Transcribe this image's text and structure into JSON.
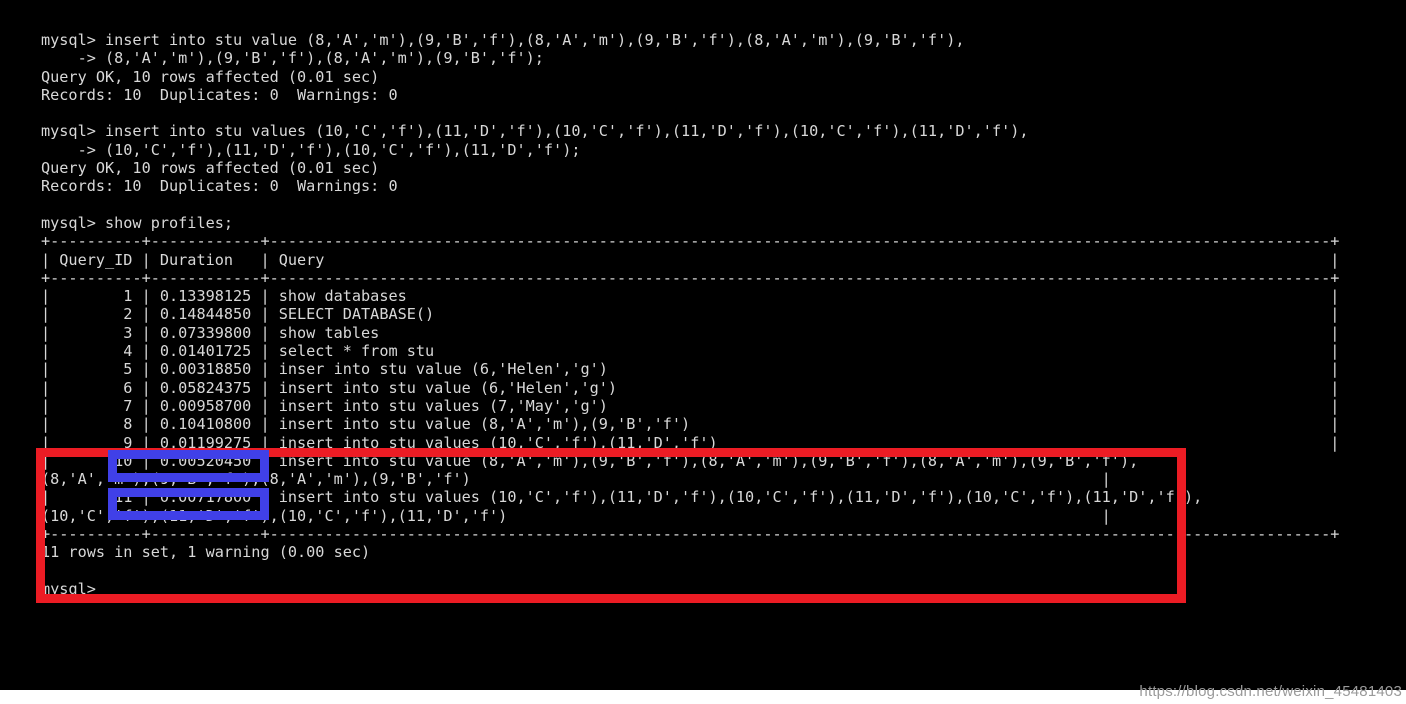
{
  "watermark": {
    "text": "https://blog.csdn.net/weixin_45481403"
  },
  "colors": {
    "terminal_background": "#000000",
    "terminal_text": "#d8d8d8",
    "page_background": "#ffffff",
    "annotation_red": "#ec1c24",
    "annotation_blue": "#4040e8"
  },
  "terminal": {
    "prompt": "mysql>",
    "continuation_prompt": "->",
    "lines": [
      "mysql> insert into stu value (8,'A','m'),(9,'B','f'),(8,'A','m'),(9,'B','f'),(8,'A','m'),(9,'B','f'),",
      "    -> (8,'A','m'),(9,'B','f'),(8,'A','m'),(9,'B','f');",
      "Query OK, 10 rows affected (0.01 sec)",
      "Records: 10  Duplicates: 0  Warnings: 0",
      "",
      "mysql> insert into stu values (10,'C','f'),(11,'D','f'),(10,'C','f'),(11,'D','f'),(10,'C','f'),(11,'D','f'),",
      "    -> (10,'C','f'),(11,'D','f'),(10,'C','f'),(11,'D','f');",
      "Query OK, 10 rows affected (0.01 sec)",
      "Records: 10  Duplicates: 0  Warnings: 0",
      "",
      "mysql> show profiles;",
      "+----------+------------+--------------------------------------------------------------------------------------------------------------------+",
      "| Query_ID | Duration   | Query                                                                                                              |",
      "+----------+------------+--------------------------------------------------------------------------------------------------------------------+",
      "|        1 | 0.13398125 | show databases                                                                                                     |",
      "|        2 | 0.14844850 | SELECT DATABASE()                                                                                                  |",
      "|        3 | 0.07339800 | show tables                                                                                                        |",
      "|        4 | 0.01401725 | select * from stu                                                                                                  |",
      "|        5 | 0.00318850 | inser into stu value (6,'Helen','g')                                                                               |",
      "|        6 | 0.05824375 | insert into stu value (6,'Helen','g')                                                                              |",
      "|        7 | 0.00958700 | insert into stu values (7,'May','g')                                                                               |",
      "|        8 | 0.10410800 | insert into stu value (8,'A','m'),(9,'B','f')                                                                      |",
      "|        9 | 0.01199275 | insert into stu values (10,'C','f'),(11,'D','f')                                                                   |",
      "|       10 | 0.00520450 | insert into stu value (8,'A','m'),(9,'B','f'),(8,'A','m'),(9,'B','f'),(8,'A','m'),(9,'B','f'),",
      "(8,'A','m'),(9,'B','f'),(8,'A','m'),(9,'B','f')                                                                     |",
      "|       11 | 0.00717800 | insert into stu values (10,'C','f'),(11,'D','f'),(10,'C','f'),(11,'D','f'),(10,'C','f'),(11,'D','f'),",
      "(10,'C','f'),(11,'D','f'),(10,'C','f'),(11,'D','f')                                                                 |",
      "+----------+------------+--------------------------------------------------------------------------------------------------------------------+",
      "11 rows in set, 1 warning (0.00 sec)",
      "",
      "mysql>"
    ],
    "table": {
      "headers": [
        "Query_ID",
        "Duration",
        "Query"
      ],
      "rows": [
        {
          "query_id": "1",
          "duration": "0.13398125",
          "query": "show databases"
        },
        {
          "query_id": "2",
          "duration": "0.14844850",
          "query": "SELECT DATABASE()"
        },
        {
          "query_id": "3",
          "duration": "0.07339800",
          "query": "show tables"
        },
        {
          "query_id": "4",
          "duration": "0.01401725",
          "query": "select * from stu"
        },
        {
          "query_id": "5",
          "duration": "0.00318850",
          "query": "inser into stu value (6,'Helen','g')"
        },
        {
          "query_id": "6",
          "duration": "0.05824375",
          "query": "insert into stu value (6,'Helen','g')"
        },
        {
          "query_id": "7",
          "duration": "0.00958700",
          "query": "insert into stu values (7,'May','g')"
        },
        {
          "query_id": "8",
          "duration": "0.10410800",
          "query": "insert into stu value (8,'A','m'),(9,'B','f')"
        },
        {
          "query_id": "9",
          "duration": "0.01199275",
          "query": "insert into stu values (10,'C','f'),(11,'D','f')"
        },
        {
          "query_id": "10",
          "duration": "0.00520450",
          "query": "insert into stu value (8,'A','m'),(9,'B','f'),(8,'A','m'),(9,'B','f'),(8,'A','m'),(9,'B','f'),(8,'A','m'),(9,'B','f'),(8,'A','m'),(9,'B','f')"
        },
        {
          "query_id": "11",
          "duration": "0.00717800",
          "query": "insert into stu values (10,'C','f'),(11,'D','f'),(10,'C','f'),(11,'D','f'),(10,'C','f'),(11,'D','f'),(10,'C','f'),(11,'D','f'),(10,'C','f'),(11,'D','f')"
        }
      ],
      "footer": "11 rows in set, 1 warning (0.00 sec)"
    },
    "statements": [
      {
        "command": "insert into stu value (8,'A','m'),(9,'B','f'),(8,'A','m'),(9,'B','f'),(8,'A','m'),(9,'B','f'),",
        "continuation": "(8,'A','m'),(9,'B','f'),(8,'A','m'),(9,'B','f');",
        "result": "Query OK, 10 rows affected (0.01 sec)",
        "records": "Records: 10  Duplicates: 0  Warnings: 0"
      },
      {
        "command": "insert into stu values (10,'C','f'),(11,'D','f'),(10,'C','f'),(11,'D','f'),(10,'C','f'),(11,'D','f'),",
        "continuation": "(10,'C','f'),(11,'D','f'),(10,'C','f'),(11,'D','f');",
        "result": "Query OK, 10 rows affected (0.01 sec)",
        "records": "Records: 10  Duplicates: 0  Warnings: 0"
      },
      {
        "command": "show profiles;",
        "continuation": "",
        "result": "",
        "records": ""
      }
    ]
  },
  "annotations": [
    {
      "name": "red-highlight-box",
      "shape": "rectangle-outline",
      "color": "#ec1c24"
    },
    {
      "name": "blue-highlight-row-10",
      "shape": "rectangle-outline",
      "color": "#4040e8"
    },
    {
      "name": "blue-highlight-row-11",
      "shape": "rectangle-outline",
      "color": "#4040e8"
    }
  ]
}
